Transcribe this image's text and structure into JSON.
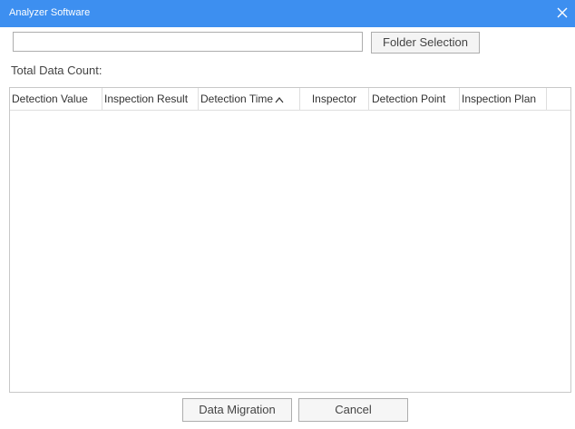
{
  "window": {
    "title": "Analyzer Software",
    "close_icon": "close-icon"
  },
  "path_input": {
    "value": "",
    "placeholder": ""
  },
  "folder_button": {
    "label": "Folder Selection"
  },
  "total_count": {
    "label": "Total Data Count:",
    "value": ""
  },
  "table": {
    "columns": [
      {
        "label": "Detection Value"
      },
      {
        "label": "Inspection Result"
      },
      {
        "label": "Detection Time",
        "sort": "ascending",
        "sort_icon": "chevron-up-icon"
      },
      {
        "label": "Inspector"
      },
      {
        "label": "Detection Point"
      },
      {
        "label": "Inspection Plan"
      }
    ],
    "rows": []
  },
  "footer": {
    "migrate_label": "Data Migration",
    "cancel_label": "Cancel"
  },
  "colors": {
    "titlebar": "#3d8ff0",
    "title_text": "#ffffff"
  }
}
